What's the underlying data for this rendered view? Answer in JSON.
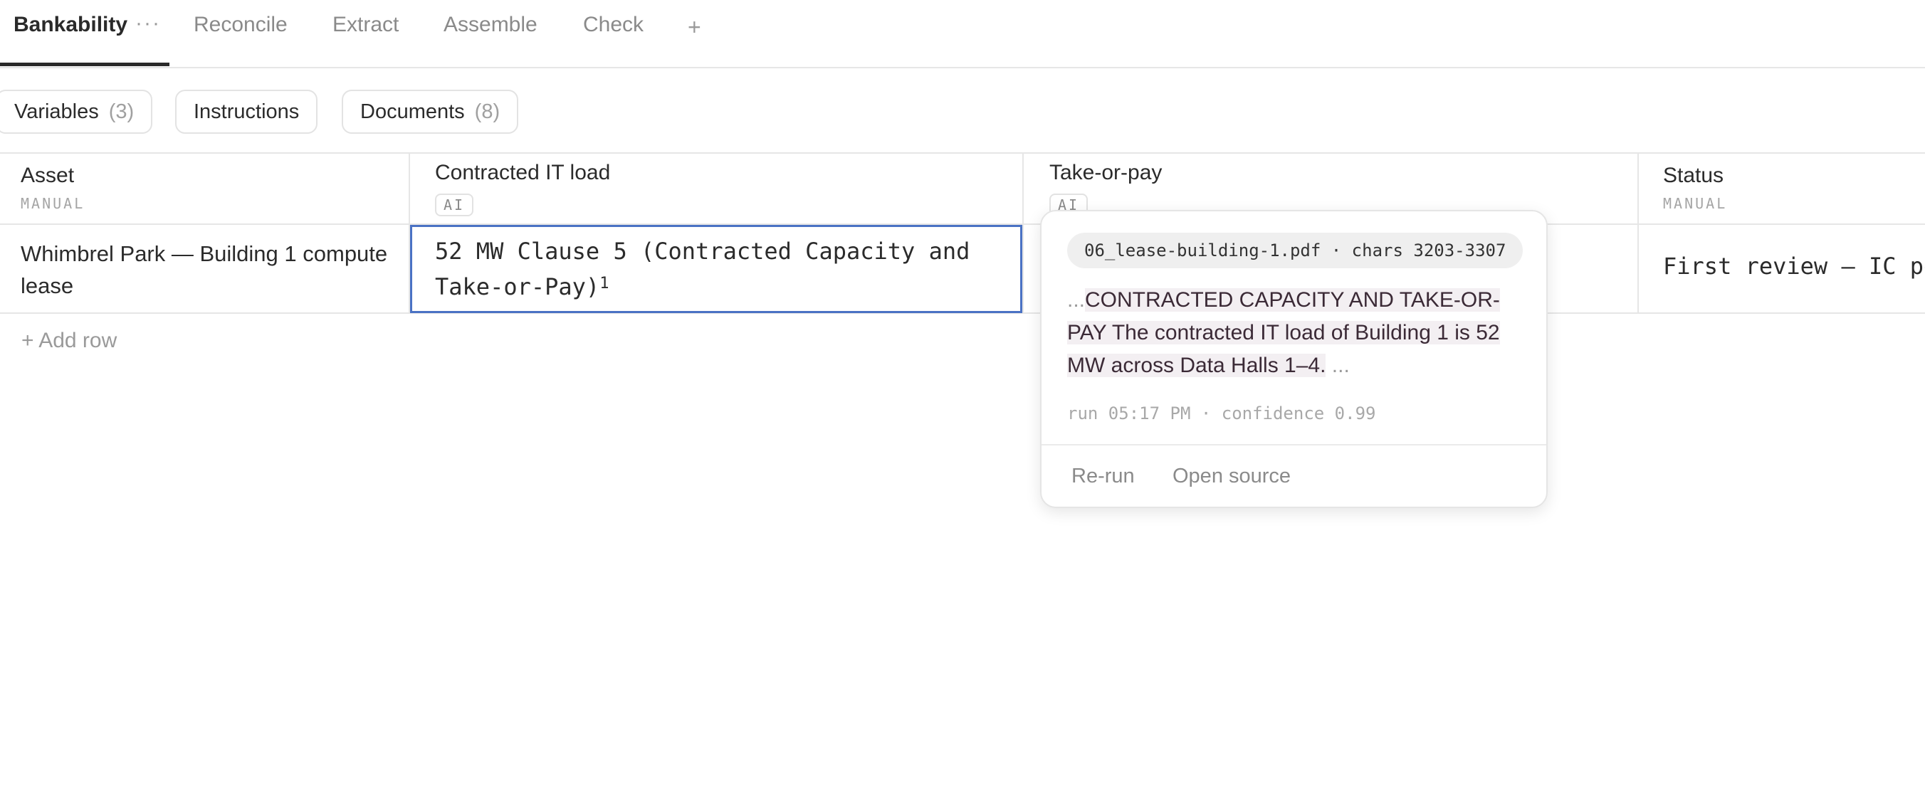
{
  "tabs": {
    "items": [
      {
        "label": "Bankability",
        "active": true
      },
      {
        "label": "Reconcile"
      },
      {
        "label": "Extract"
      },
      {
        "label": "Assemble"
      },
      {
        "label": "Check"
      }
    ],
    "more": "···",
    "add": "+"
  },
  "pills": [
    {
      "label": "Variables",
      "count": "(3)"
    },
    {
      "label": "Instructions"
    },
    {
      "label": "Documents",
      "count": "(8)"
    }
  ],
  "columns": [
    {
      "title": "Asset",
      "sub": "MANUAL"
    },
    {
      "title": "Contracted IT load",
      "badge": "AI"
    },
    {
      "title": "Take-or-pay",
      "badge": "AI"
    },
    {
      "title": "Status",
      "sub": "MANUAL"
    }
  ],
  "row": {
    "asset": "Whimbrel Park — Building 1 compute lease",
    "contracted_load": "52 MW Clause 5 (Contracted Capacity and Take-or-Pay)",
    "contracted_load_ref": "1",
    "status": "First review — IC pe"
  },
  "add_row": "+ Add row",
  "popover": {
    "source": "06_lease-building-1.pdf · chars 3203-3307",
    "ellipsis_start": "...",
    "excerpt": "CONTRACTED CAPACITY AND TAKE-OR-PAY The contracted IT load of Building 1 is 52 MW across Data Halls 1–4.",
    "ellipsis_end": " ...",
    "meta": "run 05:17 PM · confidence 0.99",
    "actions": {
      "rerun": "Re-run",
      "open": "Open source"
    }
  },
  "colors": {
    "accent": "#4a72c4",
    "highlight": "#f3eff2"
  }
}
